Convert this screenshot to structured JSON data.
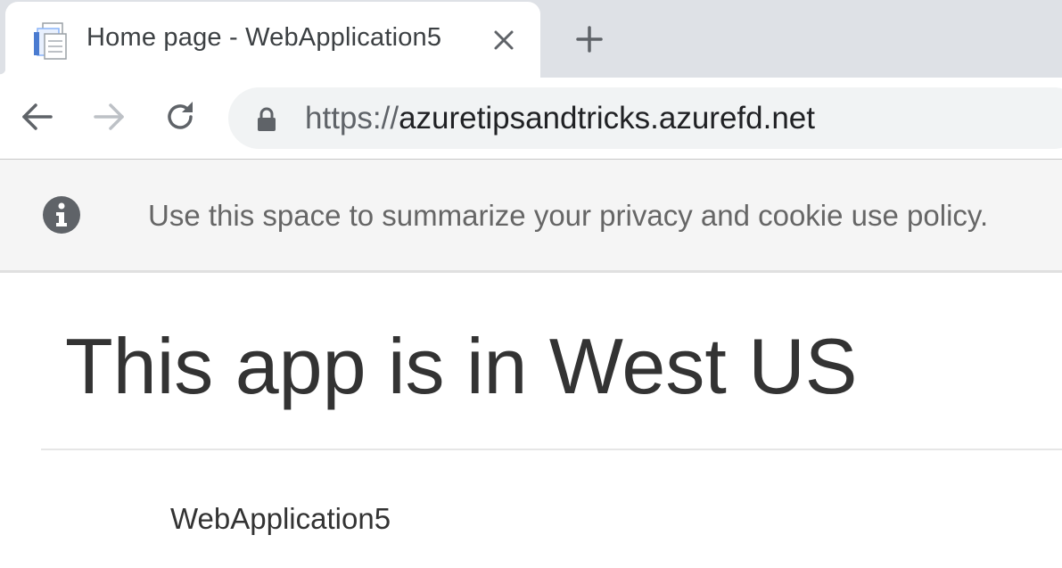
{
  "browser": {
    "tab": {
      "title": "Home page - WebApplication5",
      "favicon": "document-page-icon",
      "close_icon": "close-icon"
    },
    "new_tab_icon": "plus-icon",
    "nav": {
      "back_icon": "arrow-left-icon",
      "forward_icon": "arrow-right-icon",
      "reload_icon": "reload-icon"
    },
    "address": {
      "lock_icon": "lock-icon",
      "scheme": "https://",
      "host": "azuretipsandtricks.azurefd.net"
    }
  },
  "cookie_banner": {
    "icon": "info-icon",
    "text": "Use this space to summarize your privacy and cookie use policy."
  },
  "main": {
    "heading": "This app is in West US"
  },
  "footer": {
    "text": "WebApplication5"
  },
  "colors": {
    "tabstrip_bg": "#dee1e6",
    "omnibox_bg": "#f1f3f4",
    "banner_bg": "#f5f5f5",
    "text_dark": "#333333"
  }
}
